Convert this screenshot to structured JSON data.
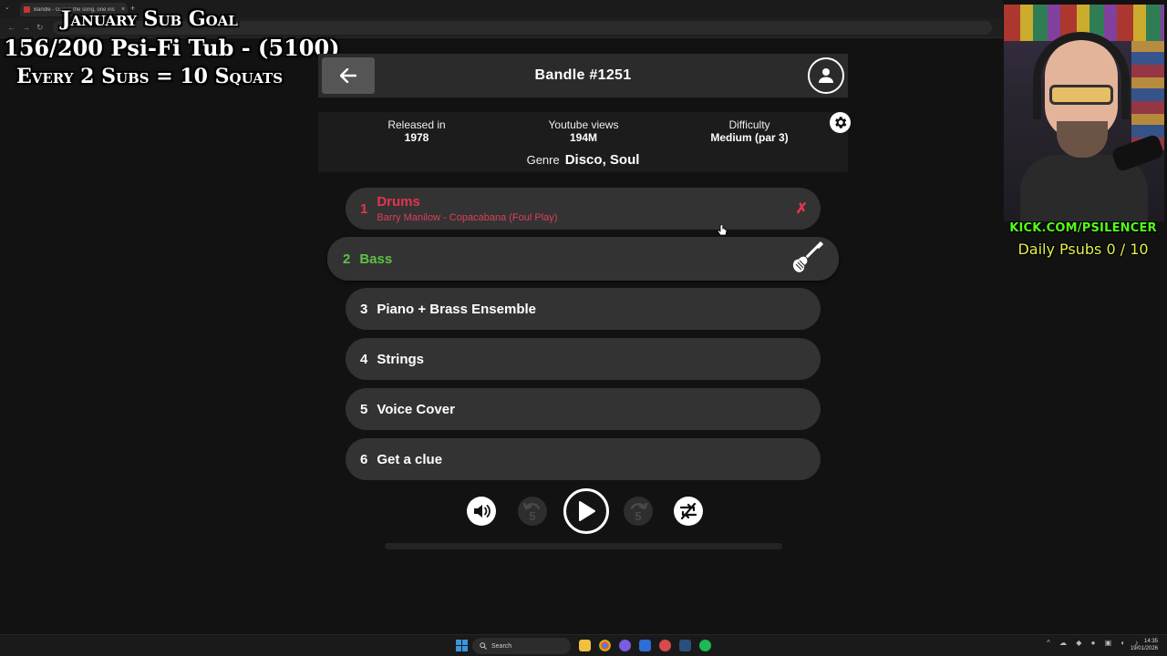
{
  "browser": {
    "tab_title": "Bandle - Guess the song, one instrument at a time",
    "tab_close": "×",
    "new_tab": "+",
    "tab_menu": "⌄",
    "nav_back": "←",
    "nav_forward": "→",
    "nav_reload": "↻"
  },
  "overlay": {
    "goal_title": "January Sub Goal",
    "goal_progress": "156/200 Psi-Fi Tub - (5100)",
    "goal_rule": "Every 2 Subs = 10 Squats",
    "kick_url": "KICK.COM/PSILENCER",
    "daily_psubs": "Daily Psubs 0 / 10"
  },
  "header": {
    "back_icon": "arrow-left-icon",
    "title": "Bandle #1251",
    "profile_icon": "user-icon"
  },
  "info": {
    "released_label": "Released in",
    "released_value": "1978",
    "views_label": "Youtube views",
    "views_value": "194M",
    "difficulty_label": "Difficulty",
    "difficulty_value": "Medium (par 3)",
    "genre_label": "Genre",
    "genre_value": "Disco, Soul",
    "settings_icon": "gear-icon"
  },
  "tracks": [
    {
      "num": "1",
      "label": "Drums",
      "sub": "Barry Manilow - Copacabana (Foul Play)",
      "mark": "✗",
      "state": "wrong"
    },
    {
      "num": "2",
      "label": "Bass",
      "state": "active",
      "icon": "bass-guitar-icon"
    },
    {
      "num": "3",
      "label": "Piano + Brass Ensemble",
      "state": "locked"
    },
    {
      "num": "4",
      "label": "Strings",
      "state": "locked"
    },
    {
      "num": "5",
      "label": "Voice Cover",
      "state": "locked"
    },
    {
      "num": "6",
      "label": "Get a clue",
      "state": "locked"
    }
  ],
  "controls": {
    "volume_icon": "volume-icon",
    "back5_label": "5",
    "play_icon": "play-icon",
    "fwd5_label": "5",
    "shuffle_icon": "shuffle-off-icon",
    "progress": 0
  },
  "taskbar": {
    "search_label": "Search",
    "time": "14:35",
    "date": "19/01/2026"
  },
  "colors": {
    "wrong": "#e3344e",
    "active": "#5ec145",
    "accent_kick": "#53fc18",
    "psubs": "#e6f04a"
  }
}
